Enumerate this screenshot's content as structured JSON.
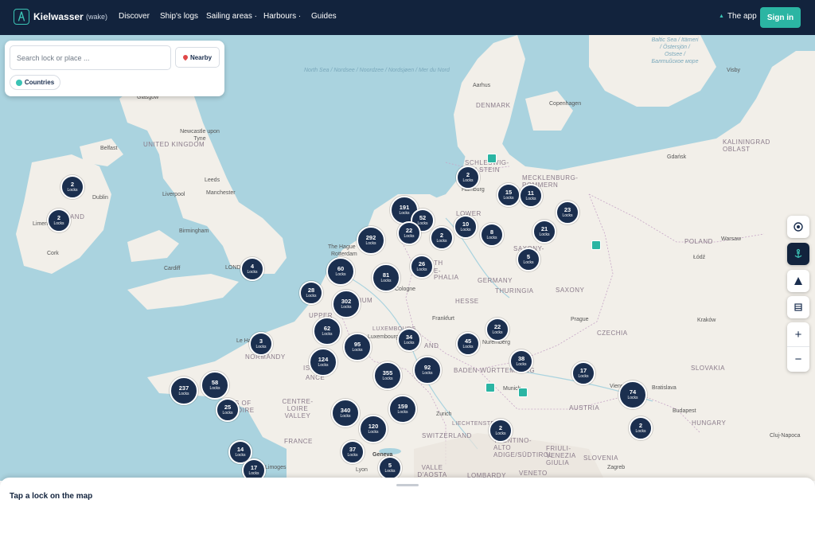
{
  "header": {
    "brand": "Kielwasser",
    "brand_sub": "(wake)",
    "nav": [
      "Discover",
      "Ship's logs",
      "Sailing areas ·",
      "Harbours ·",
      "Guides"
    ],
    "app_link": "The app",
    "signin": "Sign in"
  },
  "search": {
    "placeholder": "Search lock or place ...",
    "nearby": "Nearby",
    "countries": "Countries"
  },
  "sheet": {
    "title": "Tap a lock on the map"
  },
  "map": {
    "countries": [
      "UNITED KINGDOM",
      "DENMARK",
      "GERMANY",
      "POLAND",
      "CZECHIA",
      "AUSTRIA",
      "SLOVAKIA",
      "HUNGARY",
      "FRANCE",
      "SWITZERLAND",
      "SLOVENIA",
      "LIECHTENSTEIN",
      "IUM",
      "HESSE",
      "THURINGIA",
      "SAXONY",
      "BADEN-WÜRTTEMBERG",
      "NORMANDY",
      "KALININGRAD OBLAST",
      "MECKLENBURG-POMMERN",
      "SCHLESWIG-HOLSTEIN",
      "CENTRE-LOIRE VALLEY",
      "LUXEMBOURG",
      "AND",
      "VALLE D'AOSTA",
      "TRENTINO-ALTO ADIGE/SÜDTIROL",
      "FRIULI-VENEZIA GIULIA",
      "LOMBARDY",
      "VENETO",
      "UPPER",
      "SAXONY-",
      "LOWER",
      "TH",
      "E-",
      "PHALIA",
      "IS",
      "ANCE",
      "S OF",
      "OIRE",
      "LAND"
    ],
    "cities": [
      "Glasgow",
      "Belfast",
      "Dublin",
      "Limerick",
      "Cork",
      "Newcastle upon Tyne",
      "Leeds",
      "Manchester",
      "Liverpool",
      "Birmingham",
      "Cardiff",
      "LOND",
      "Aarhus",
      "Copenhagen",
      "Visby",
      "Gdańsk",
      "Hamburg",
      "Warsaw",
      "Łódź",
      "Kraków",
      "Prague",
      "Bratislava",
      "Budapest",
      "Cluj-Napoca",
      "Zagreb",
      "Frankfurt",
      "Nuremberg",
      "Munich",
      "Zurich",
      "Geneva",
      "Lyon",
      "Limoges",
      "The Hague",
      "Rotterdam",
      "Cologne",
      "Luxembourg",
      "Le Havre",
      "Vienna"
    ],
    "seas": [
      "North Sea / Nordsee / Noordzee / Nordsjøen / Mer du Nord",
      "Baltic Sea / Itämeri / Östersjön / Ostsee / Балтийское море"
    ],
    "clusters": [
      {
        "n": "2",
        "unit": "Locks"
      },
      {
        "n": "2",
        "unit": "Locks"
      },
      {
        "n": "2",
        "unit": "Locks"
      },
      {
        "n": "191",
        "unit": "Locks"
      },
      {
        "n": "52",
        "unit": "Locks"
      },
      {
        "n": "15",
        "unit": "Locks"
      },
      {
        "n": "11",
        "unit": "Locks"
      },
      {
        "n": "23",
        "unit": "Locks"
      },
      {
        "n": "22",
        "unit": "Locks"
      },
      {
        "n": "2",
        "unit": "Locks"
      },
      {
        "n": "10",
        "unit": "Locks"
      },
      {
        "n": "8",
        "unit": "Locks"
      },
      {
        "n": "21",
        "unit": "Locks"
      },
      {
        "n": "292",
        "unit": "Locks"
      },
      {
        "n": "26",
        "unit": "Locks"
      },
      {
        "n": "5",
        "unit": "Locks"
      },
      {
        "n": "4",
        "unit": "Locks"
      },
      {
        "n": "60",
        "unit": "Locks"
      },
      {
        "n": "81",
        "unit": "Locks"
      },
      {
        "n": "28",
        "unit": "Locks"
      },
      {
        "n": "302",
        "unit": "Locks"
      },
      {
        "n": "62",
        "unit": "Locks"
      },
      {
        "n": "95",
        "unit": "Locks"
      },
      {
        "n": "34",
        "unit": "Locks"
      },
      {
        "n": "45",
        "unit": "Locks"
      },
      {
        "n": "22",
        "unit": "Locks"
      },
      {
        "n": "3",
        "unit": "Locks"
      },
      {
        "n": "124",
        "unit": "Locks"
      },
      {
        "n": "355",
        "unit": "Locks"
      },
      {
        "n": "92",
        "unit": "Locks"
      },
      {
        "n": "38",
        "unit": "Locks"
      },
      {
        "n": "17",
        "unit": "Locks"
      },
      {
        "n": "237",
        "unit": "Locks"
      },
      {
        "n": "58",
        "unit": "Locks"
      },
      {
        "n": "25",
        "unit": "Locks"
      },
      {
        "n": "74",
        "unit": "Locks"
      },
      {
        "n": "340",
        "unit": "Locks"
      },
      {
        "n": "159",
        "unit": "Locks"
      },
      {
        "n": "120",
        "unit": "Locks"
      },
      {
        "n": "2",
        "unit": "Locks"
      },
      {
        "n": "2",
        "unit": "Locks"
      },
      {
        "n": "14",
        "unit": "Locks"
      },
      {
        "n": "37",
        "unit": "Locks"
      },
      {
        "n": "5",
        "unit": "Locks"
      },
      {
        "n": "17",
        "unit": "Locks"
      }
    ]
  },
  "controls": [
    "locate-icon",
    "anchor-icon",
    "north-arrow-icon",
    "layers-icon",
    "+",
    "−"
  ],
  "colors": {
    "navy": "#12233d",
    "teal": "#2bb5a3",
    "cluster": "#1b2f4f",
    "water": "#aad3df",
    "land": "#f2efe9"
  }
}
